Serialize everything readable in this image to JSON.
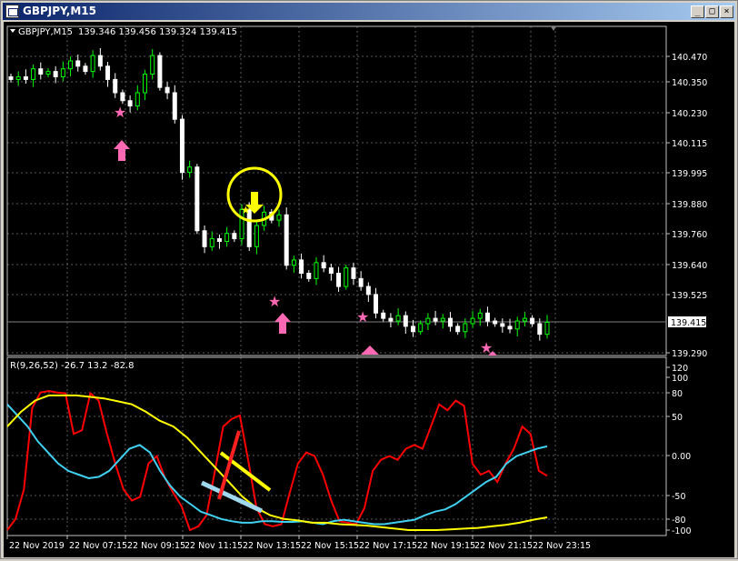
{
  "window": {
    "title": "GBPJPY,M15",
    "minimize_glyph": "_",
    "maximize_glyph": "□",
    "close_glyph": "×"
  },
  "chart_header": {
    "symbol_label": "GBPJPY,M15",
    "ohlc": "139.346 139.456 139.324 139.415"
  },
  "price_axis": {
    "ticks": [
      "140.470",
      "140.350",
      "140.230",
      "140.115",
      "139.995",
      "139.880",
      "139.760",
      "139.640",
      "139.525",
      "139.415",
      "139.290"
    ],
    "current_price": "139.415"
  },
  "indicator": {
    "label": "R(9,26,52) -26.7 13.2 -82.8",
    "ticks": [
      "120",
      "100",
      "80",
      "50",
      "0.00",
      "-50",
      "-80",
      "-100"
    ]
  },
  "time_axis": {
    "ticks": [
      "22 Nov 2019",
      "22 Nov 07:15",
      "22 Nov 09:15",
      "22 Nov 11:15",
      "22 Nov 13:15",
      "22 Nov 15:15",
      "22 Nov 17:15",
      "22 Nov 19:15",
      "22 Nov 21:15",
      "22 Nov 23:15"
    ]
  },
  "colors": {
    "background": "#000000",
    "bull_candle": "#00ff00",
    "bear_candle": "#ffffff",
    "grid": "#5a5a5a",
    "current_price_line": "#808080",
    "signal_markers": "#ff69b4",
    "highlight_circle": "#ffff00",
    "red_line": "#ff0000",
    "cyan_line": "#40d0f0",
    "yellow_line": "#ffff00"
  },
  "chart_data": [
    {
      "type": "candlestick",
      "symbol": "GBPJPY",
      "timeframe": "M15",
      "ylim": [
        139.29,
        140.53
      ],
      "close_path": [
        140.33,
        140.34,
        140.33,
        140.37,
        140.35,
        140.36,
        140.34,
        140.37,
        140.4,
        140.38,
        140.36,
        140.42,
        140.38,
        140.33,
        140.28,
        140.25,
        140.23,
        140.28,
        140.35,
        140.42,
        140.3,
        140.28,
        140.18,
        139.98,
        140.0,
        139.76,
        139.7,
        139.73,
        139.72,
        139.75,
        139.73,
        139.84,
        139.7,
        139.78,
        139.83,
        139.8,
        139.82,
        139.63,
        139.65,
        139.6,
        139.58,
        139.64,
        139.62,
        139.6,
        139.55,
        139.62,
        139.58,
        139.55,
        139.52,
        139.45,
        139.43,
        139.42,
        139.44,
        139.4,
        139.38,
        139.41,
        139.43,
        139.42,
        139.43,
        139.4,
        139.38,
        139.41,
        139.43,
        139.45,
        139.42,
        139.41,
        139.4,
        139.39,
        139.42,
        139.43,
        139.41,
        139.37,
        139.415
      ]
    },
    {
      "type": "line",
      "title": "R(9,26,52)",
      "ylim": [
        -100,
        120
      ],
      "series": [
        {
          "color": "#ff0000",
          "values": [
            -100,
            -85,
            -45,
            65,
            86,
            88,
            86,
            85,
            30,
            35,
            85,
            75,
            30,
            -10,
            -45,
            -60,
            -55,
            -10,
            0,
            -30,
            -50,
            -68,
            -100,
            -95,
            -80,
            -20,
            40,
            50,
            55,
            -5,
            -70,
            -92,
            -95,
            -92,
            -50,
            -10,
            5,
            0,
            -25,
            -60,
            -88,
            -90,
            -92,
            -70,
            -20,
            -5,
            0,
            -5,
            10,
            15,
            10,
            40,
            70,
            62,
            75,
            68,
            -10,
            -25,
            -20,
            -35,
            -10,
            10,
            40,
            30,
            -20,
            -26.7
          ]
        },
        {
          "color": "#40d0f0",
          "values": [
            70,
            55,
            40,
            20,
            5,
            -10,
            -20,
            -25,
            -30,
            -28,
            -20,
            -5,
            10,
            15,
            5,
            -20,
            -40,
            -55,
            -65,
            -75,
            -80,
            -85,
            -88,
            -90,
            -90,
            -88,
            -88,
            -89,
            -89,
            -88,
            -90,
            -92,
            -88,
            -86,
            -88,
            -90,
            -92,
            -92,
            -90,
            -88,
            -86,
            -80,
            -75,
            -72,
            -65,
            -55,
            -45,
            -35,
            -28,
            -10,
            0,
            5,
            10,
            13.2
          ]
        },
        {
          "color": "#ffff00",
          "values": [
            40,
            60,
            75,
            82,
            82,
            82,
            80,
            78,
            74,
            70,
            60,
            48,
            40,
            25,
            5,
            -15,
            -35,
            -55,
            -70,
            -80,
            -85,
            -87,
            -90,
            -90,
            -92,
            -93,
            -94,
            -96,
            -98,
            -100,
            -100,
            -100,
            -99,
            -98,
            -97,
            -95,
            -93,
            -90,
            -86,
            -82.8
          ]
        }
      ]
    }
  ]
}
